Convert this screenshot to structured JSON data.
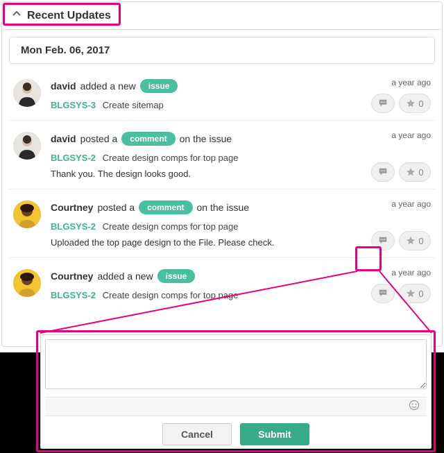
{
  "section": {
    "title": "Recent Updates"
  },
  "date": "Mon Feb. 06, 2017",
  "timestamp": "a year ago",
  "badges": {
    "issue": "issue",
    "comment": "comment"
  },
  "text": {
    "added_new": "added a new",
    "posted_a": "posted a",
    "on_issue": "on the issue"
  },
  "items": [
    {
      "user": "david",
      "action": "added",
      "badge": "issue",
      "key": "BLGSYS-3",
      "title": "Create sitemap",
      "body": "",
      "stars": 0,
      "avatar": "a"
    },
    {
      "user": "david",
      "action": "comment",
      "badge": "comment",
      "key": "BLGSYS-2",
      "title": "Create design comps for top page",
      "body": "Thank you. The design looks good.",
      "stars": 0,
      "avatar": "a"
    },
    {
      "user": "Courtney",
      "action": "comment",
      "badge": "comment",
      "key": "BLGSYS-2",
      "title": "Create design comps for top page",
      "body": "Uploaded the top page design to the File. Please check.",
      "stars": 0,
      "avatar": "b"
    },
    {
      "user": "Courtney",
      "action": "added",
      "badge": "issue",
      "key": "BLGSYS-2",
      "title": "Create design comps for top page",
      "body": "",
      "stars": 0,
      "avatar": "b"
    }
  ],
  "buttons": {
    "cancel": "Cancel",
    "submit": "Submit"
  },
  "colors": {
    "accent": "#4abf9f",
    "link": "#3fb392",
    "highlight": "#e6007e"
  }
}
